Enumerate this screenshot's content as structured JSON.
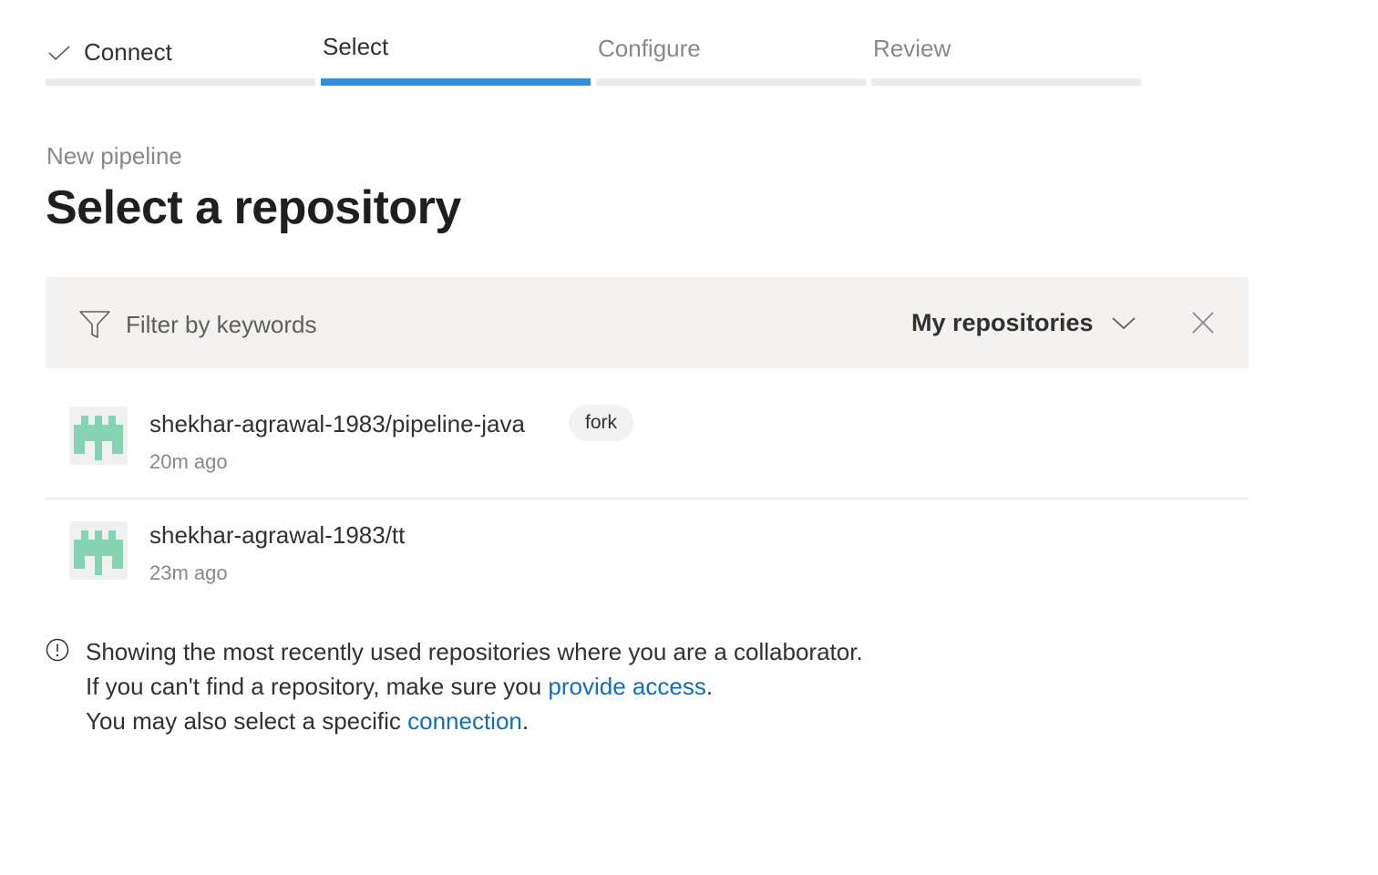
{
  "stepper": {
    "steps": [
      {
        "label": "Connect",
        "state": "done"
      },
      {
        "label": "Select",
        "state": "active"
      },
      {
        "label": "Configure",
        "state": "pending"
      },
      {
        "label": "Review",
        "state": "pending"
      }
    ]
  },
  "header": {
    "subtitle": "New pipeline",
    "title": "Select a repository"
  },
  "filter": {
    "placeholder": "Filter by keywords",
    "value": "",
    "dropdown_selected": "My repositories",
    "icons": {
      "filter": "filter-icon",
      "dropdown": "chevron-down-icon",
      "clear": "close-icon"
    }
  },
  "repositories": [
    {
      "name": "shekhar-agrawal-1983/pipeline-java",
      "badge": "fork",
      "updated": "20m ago"
    },
    {
      "name": "shekhar-agrawal-1983/tt",
      "badge": "",
      "updated": "23m ago"
    }
  ],
  "info": {
    "line1": "Showing the most recently used repositories where you are a collaborator.",
    "line2_prefix": "If you can't find a repository, make sure you ",
    "line2_link": "provide access",
    "line2_suffix": ".",
    "line3_prefix": "You may also select a specific ",
    "line3_link": "connection",
    "line3_suffix": "."
  },
  "colors": {
    "accent": "#2f8dd9",
    "link": "#106ebe",
    "avatar": "#86d4b4"
  }
}
